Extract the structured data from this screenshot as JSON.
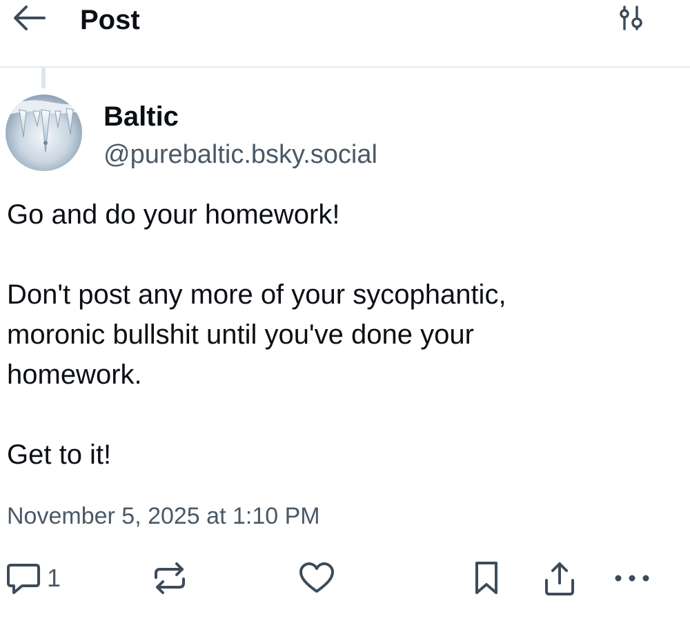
{
  "header": {
    "title": "Post",
    "back_icon": "arrow-left-icon",
    "filter_icon": "sliders-icon"
  },
  "post": {
    "author": {
      "display_name": "Baltic",
      "handle": "@purebaltic.bsky.social"
    },
    "text": "Go and do your homework!\n\nDon't post any more of your sycophantic,\nmoronic bullshit until you've done your\nhomework.\n\nGet to it!",
    "timestamp": "November 5, 2025 at 1:10 PM"
  },
  "actions": {
    "reply_count": "1",
    "icons": [
      "reply-icon",
      "repost-icon",
      "like-icon",
      "bookmark-icon",
      "share-icon",
      "more-icon"
    ]
  },
  "colors": {
    "text": "#0b0f14",
    "secondary": "#4b5866",
    "icon": "#3d4b5a",
    "divider": "#e6eaee"
  }
}
